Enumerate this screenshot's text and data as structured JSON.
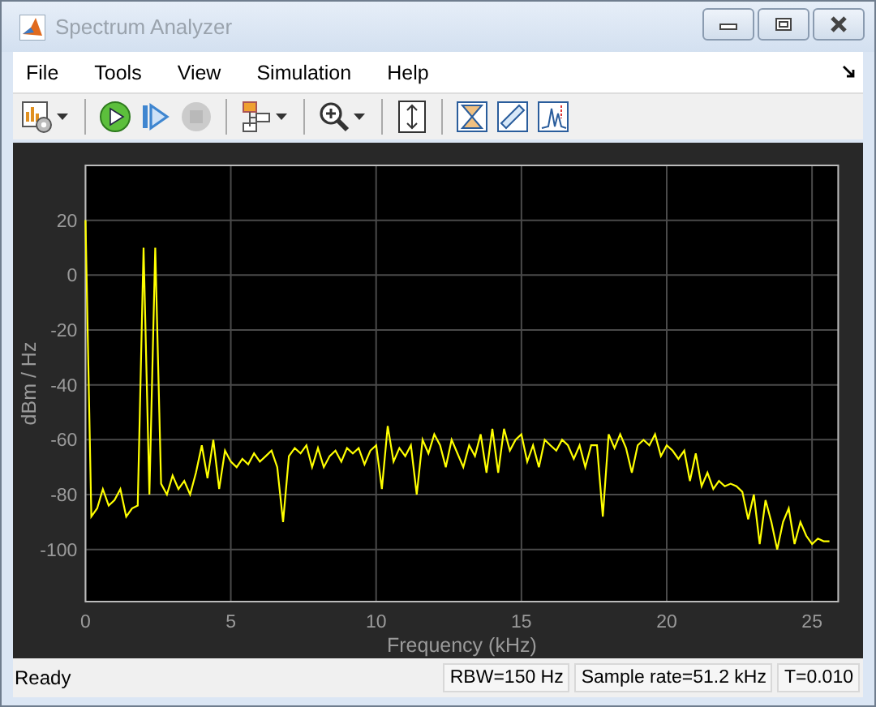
{
  "window": {
    "title": "Spectrum Analyzer"
  },
  "menu": [
    "File",
    "Tools",
    "View",
    "Simulation",
    "Help"
  ],
  "toolbar": [
    [
      {
        "kind": "settings",
        "dropdown": true,
        "disabled": false
      }
    ],
    [
      {
        "kind": "run",
        "dropdown": false,
        "disabled": false
      },
      {
        "kind": "step",
        "dropdown": false,
        "disabled": false
      },
      {
        "kind": "stop",
        "dropdown": false,
        "disabled": true
      }
    ],
    [
      {
        "kind": "signals",
        "dropdown": true,
        "disabled": false
      }
    ],
    [
      {
        "kind": "zoom",
        "dropdown": true,
        "disabled": false
      }
    ],
    [
      {
        "kind": "scale",
        "dropdown": false,
        "disabled": false
      }
    ],
    [
      {
        "kind": "trigger",
        "dropdown": false,
        "disabled": false
      },
      {
        "kind": "measure",
        "dropdown": false,
        "disabled": false
      },
      {
        "kind": "peaks",
        "dropdown": false,
        "disabled": false
      }
    ]
  ],
  "chart_data": {
    "type": "line",
    "grid": true,
    "xlabel": "Frequency (kHz)",
    "ylabel": "dBm / Hz",
    "xlim": [
      0,
      25.9
    ],
    "ylim": [
      -119,
      40
    ],
    "xticks": [
      0,
      5,
      10,
      15,
      20,
      25
    ],
    "yticks": [
      -100,
      -80,
      -60,
      -40,
      -20,
      0,
      20
    ],
    "x": [
      0,
      0.2,
      0.4,
      0.6,
      0.8,
      1,
      1.2,
      1.4,
      1.6,
      1.8,
      2,
      2.2,
      2.4,
      2.6,
      2.8,
      3,
      3.2,
      3.4,
      3.6,
      3.8,
      4,
      4.2,
      4.4,
      4.6,
      4.8,
      5,
      5.2,
      5.4,
      5.6,
      5.8,
      6,
      6.2,
      6.4,
      6.6,
      6.8,
      7,
      7.2,
      7.4,
      7.6,
      7.8,
      8,
      8.2,
      8.4,
      8.6,
      8.8,
      9,
      9.2,
      9.4,
      9.6,
      9.8,
      10,
      10.2,
      10.4,
      10.6,
      10.8,
      11,
      11.2,
      11.4,
      11.6,
      11.8,
      12,
      12.2,
      12.4,
      12.6,
      12.8,
      13,
      13.2,
      13.4,
      13.6,
      13.8,
      14,
      14.2,
      14.4,
      14.6,
      14.8,
      15,
      15.2,
      15.4,
      15.6,
      15.8,
      16,
      16.2,
      16.4,
      16.6,
      16.8,
      17,
      17.2,
      17.4,
      17.6,
      17.8,
      18,
      18.2,
      18.4,
      18.6,
      18.8,
      19,
      19.2,
      19.4,
      19.6,
      19.8,
      20,
      20.2,
      20.4,
      20.6,
      20.8,
      21,
      21.2,
      21.4,
      21.6,
      21.8,
      22,
      22.2,
      22.4,
      22.6,
      22.8,
      23,
      23.2,
      23.4,
      23.6,
      23.8,
      24,
      24.2,
      24.4,
      24.6,
      24.8,
      25,
      25.2,
      25.4,
      25.6
    ],
    "series": [
      {
        "color": "#ffff00",
        "values": [
          20,
          -88,
          -85,
          -78,
          -84,
          -82,
          -78,
          -88,
          -85,
          -84,
          10,
          -80,
          10,
          -76,
          -80,
          -73,
          -78,
          -75,
          -80,
          -72,
          -62,
          -74,
          -60,
          -78,
          -64,
          -68,
          -70,
          -67,
          -69,
          -65,
          -68,
          -66,
          -64,
          -70,
          -90,
          -66,
          -63,
          -65,
          -62,
          -70,
          -63,
          -70,
          -66,
          -64,
          -68,
          -63,
          -65,
          -63,
          -69,
          -64,
          -62,
          -78,
          -55,
          -68,
          -63,
          -66,
          -62,
          -80,
          -60,
          -65,
          -58,
          -62,
          -70,
          -60,
          -65,
          -70,
          -62,
          -66,
          -58,
          -72,
          -56,
          -72,
          -56,
          -64,
          -60,
          -58,
          -68,
          -62,
          -70,
          -60,
          -62,
          -64,
          -60,
          -62,
          -67,
          -62,
          -70,
          -62,
          -62,
          -88,
          -58,
          -63,
          -58,
          -63,
          -72,
          -62,
          -60,
          -62,
          -58,
          -66,
          -62,
          -64,
          -67,
          -64,
          -75,
          -65,
          -77,
          -72,
          -78,
          -75,
          -77,
          -76,
          -77,
          -79,
          -89,
          -80,
          -98,
          -82,
          -90,
          -100,
          -90,
          -85,
          -98,
          -90,
          -95,
          -98,
          -96,
          -97,
          -97
        ]
      }
    ]
  },
  "status_bar": {
    "state": "Ready",
    "fields": [
      "RBW=150 Hz",
      "Sample rate=51.2 kHz",
      "T=0.010"
    ]
  }
}
